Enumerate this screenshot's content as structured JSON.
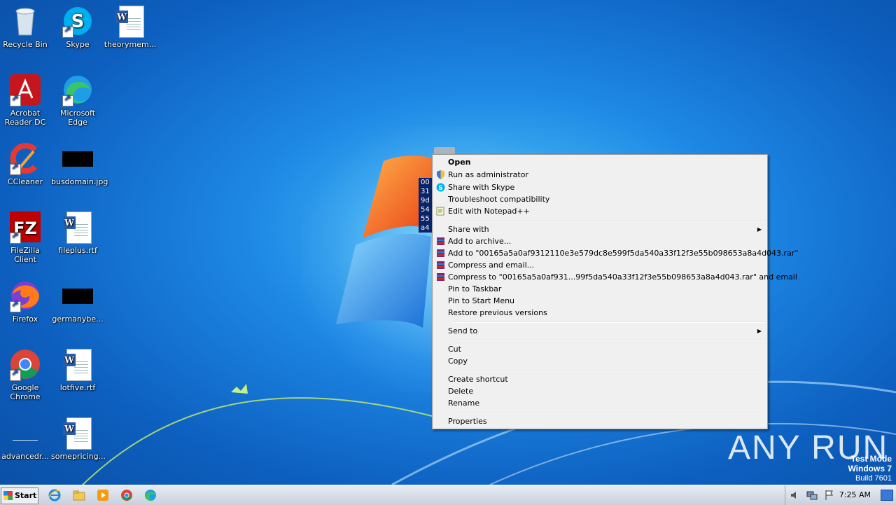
{
  "desktop": {
    "icons": [
      {
        "label": "Recycle Bin"
      },
      {
        "label": "Skype"
      },
      {
        "label": "theorymem..."
      },
      {
        "label": "Acrobat Reader DC"
      },
      {
        "label": "Microsoft Edge"
      },
      {
        "label": "CCleaner"
      },
      {
        "label": "busdomain.jpg"
      },
      {
        "label": "FileZilla Client"
      },
      {
        "label": "fileplus.rtf"
      },
      {
        "label": "Firefox"
      },
      {
        "label": "germanybe..."
      },
      {
        "label": "Google Chrome"
      },
      {
        "label": "lotfive.rtf"
      },
      {
        "label": "advancedr..."
      },
      {
        "label": "somepricing..."
      }
    ],
    "selected_file_label_fragments": [
      "00",
      "31",
      "9d",
      "54",
      "55",
      "a4"
    ]
  },
  "context_menu": {
    "items": [
      {
        "label": "Open"
      },
      {
        "label": "Run as administrator"
      },
      {
        "label": "Share with Skype"
      },
      {
        "label": "Troubleshoot compatibility"
      },
      {
        "label": "Edit with Notepad++"
      },
      {
        "label": "Share with"
      },
      {
        "label": "Add to archive..."
      },
      {
        "label": "Add to \"00165a5a0af9312110e3e579dc8e599f5da540a33f12f3e55b098653a8a4d043.rar\""
      },
      {
        "label": "Compress and email..."
      },
      {
        "label": "Compress to \"00165a5a0af931...99f5da540a33f12f3e55b098653a8a4d043.rar\" and email"
      },
      {
        "label": "Pin to Taskbar"
      },
      {
        "label": "Pin to Start Menu"
      },
      {
        "label": "Restore previous versions"
      },
      {
        "label": "Send to"
      },
      {
        "label": "Cut"
      },
      {
        "label": "Copy"
      },
      {
        "label": "Create shortcut"
      },
      {
        "label": "Delete"
      },
      {
        "label": "Rename"
      },
      {
        "label": "Properties"
      }
    ]
  },
  "taskbar": {
    "start_label": "Start",
    "clock": "7:25 AM"
  },
  "watermark": {
    "line1": "Test Mode",
    "line2": "Windows 7",
    "line3": "Build 7601",
    "brand": "ANY RUN"
  },
  "colors": {
    "desktop_blue": "#1e88e5",
    "menu_bg": "#f0f0f0",
    "taskbar": "#dde3ea"
  }
}
